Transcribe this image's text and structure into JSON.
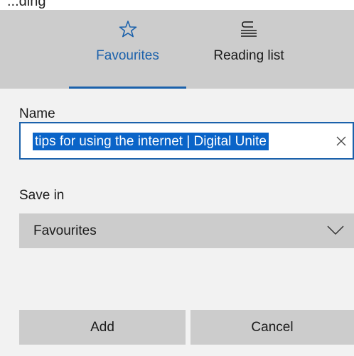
{
  "top_strip": {
    "text": "...ding"
  },
  "tabs": [
    {
      "label": "Favourites",
      "icon": "star-outline-icon",
      "active": true,
      "color": "#1b61ab"
    },
    {
      "label": "Reading list",
      "icon": "reading-list-icon",
      "active": false
    }
  ],
  "form": {
    "name_label": "Name",
    "name_value": "tips for using the internet | Digital Unite",
    "save_in_label": "Save in",
    "save_in_value": "Favourites"
  },
  "buttons": {
    "add_label": "Add",
    "cancel_label": "Cancel"
  },
  "colors": {
    "accent": "#1b61ab",
    "selection": "#0a64c8",
    "tab_bar": "#cccccc",
    "panel": "#f2f2f2"
  }
}
